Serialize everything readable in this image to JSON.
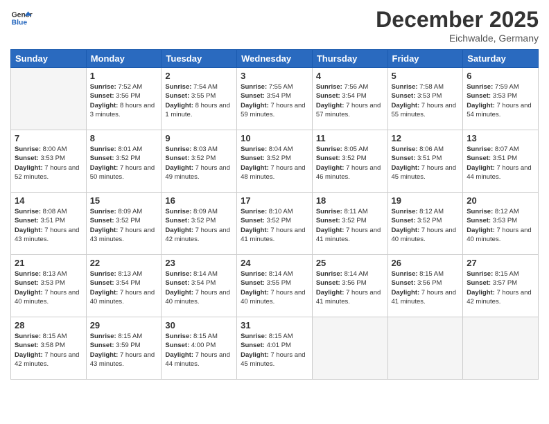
{
  "header": {
    "logo_line1": "General",
    "logo_line2": "Blue",
    "month": "December 2025",
    "location": "Eichwalde, Germany"
  },
  "weekdays": [
    "Sunday",
    "Monday",
    "Tuesday",
    "Wednesday",
    "Thursday",
    "Friday",
    "Saturday"
  ],
  "weeks": [
    [
      {
        "day": "",
        "empty": true
      },
      {
        "day": "1",
        "sunrise": "7:52 AM",
        "sunset": "3:56 PM",
        "daylight": "8 hours and 3 minutes."
      },
      {
        "day": "2",
        "sunrise": "7:54 AM",
        "sunset": "3:55 PM",
        "daylight": "8 hours and 1 minute."
      },
      {
        "day": "3",
        "sunrise": "7:55 AM",
        "sunset": "3:54 PM",
        "daylight": "7 hours and 59 minutes."
      },
      {
        "day": "4",
        "sunrise": "7:56 AM",
        "sunset": "3:54 PM",
        "daylight": "7 hours and 57 minutes."
      },
      {
        "day": "5",
        "sunrise": "7:58 AM",
        "sunset": "3:53 PM",
        "daylight": "7 hours and 55 minutes."
      },
      {
        "day": "6",
        "sunrise": "7:59 AM",
        "sunset": "3:53 PM",
        "daylight": "7 hours and 54 minutes."
      }
    ],
    [
      {
        "day": "7",
        "sunrise": "8:00 AM",
        "sunset": "3:53 PM",
        "daylight": "7 hours and 52 minutes."
      },
      {
        "day": "8",
        "sunrise": "8:01 AM",
        "sunset": "3:52 PM",
        "daylight": "7 hours and 50 minutes."
      },
      {
        "day": "9",
        "sunrise": "8:03 AM",
        "sunset": "3:52 PM",
        "daylight": "7 hours and 49 minutes."
      },
      {
        "day": "10",
        "sunrise": "8:04 AM",
        "sunset": "3:52 PM",
        "daylight": "7 hours and 48 minutes."
      },
      {
        "day": "11",
        "sunrise": "8:05 AM",
        "sunset": "3:52 PM",
        "daylight": "7 hours and 46 minutes."
      },
      {
        "day": "12",
        "sunrise": "8:06 AM",
        "sunset": "3:51 PM",
        "daylight": "7 hours and 45 minutes."
      },
      {
        "day": "13",
        "sunrise": "8:07 AM",
        "sunset": "3:51 PM",
        "daylight": "7 hours and 44 minutes."
      }
    ],
    [
      {
        "day": "14",
        "sunrise": "8:08 AM",
        "sunset": "3:51 PM",
        "daylight": "7 hours and 43 minutes."
      },
      {
        "day": "15",
        "sunrise": "8:09 AM",
        "sunset": "3:52 PM",
        "daylight": "7 hours and 43 minutes."
      },
      {
        "day": "16",
        "sunrise": "8:09 AM",
        "sunset": "3:52 PM",
        "daylight": "7 hours and 42 minutes."
      },
      {
        "day": "17",
        "sunrise": "8:10 AM",
        "sunset": "3:52 PM",
        "daylight": "7 hours and 41 minutes."
      },
      {
        "day": "18",
        "sunrise": "8:11 AM",
        "sunset": "3:52 PM",
        "daylight": "7 hours and 41 minutes."
      },
      {
        "day": "19",
        "sunrise": "8:12 AM",
        "sunset": "3:52 PM",
        "daylight": "7 hours and 40 minutes."
      },
      {
        "day": "20",
        "sunrise": "8:12 AM",
        "sunset": "3:53 PM",
        "daylight": "7 hours and 40 minutes."
      }
    ],
    [
      {
        "day": "21",
        "sunrise": "8:13 AM",
        "sunset": "3:53 PM",
        "daylight": "7 hours and 40 minutes."
      },
      {
        "day": "22",
        "sunrise": "8:13 AM",
        "sunset": "3:54 PM",
        "daylight": "7 hours and 40 minutes."
      },
      {
        "day": "23",
        "sunrise": "8:14 AM",
        "sunset": "3:54 PM",
        "daylight": "7 hours and 40 minutes."
      },
      {
        "day": "24",
        "sunrise": "8:14 AM",
        "sunset": "3:55 PM",
        "daylight": "7 hours and 40 minutes."
      },
      {
        "day": "25",
        "sunrise": "8:14 AM",
        "sunset": "3:56 PM",
        "daylight": "7 hours and 41 minutes."
      },
      {
        "day": "26",
        "sunrise": "8:15 AM",
        "sunset": "3:56 PM",
        "daylight": "7 hours and 41 minutes."
      },
      {
        "day": "27",
        "sunrise": "8:15 AM",
        "sunset": "3:57 PM",
        "daylight": "7 hours and 42 minutes."
      }
    ],
    [
      {
        "day": "28",
        "sunrise": "8:15 AM",
        "sunset": "3:58 PM",
        "daylight": "7 hours and 42 minutes."
      },
      {
        "day": "29",
        "sunrise": "8:15 AM",
        "sunset": "3:59 PM",
        "daylight": "7 hours and 43 minutes."
      },
      {
        "day": "30",
        "sunrise": "8:15 AM",
        "sunset": "4:00 PM",
        "daylight": "7 hours and 44 minutes."
      },
      {
        "day": "31",
        "sunrise": "8:15 AM",
        "sunset": "4:01 PM",
        "daylight": "7 hours and 45 minutes."
      },
      {
        "day": "",
        "empty": true
      },
      {
        "day": "",
        "empty": true
      },
      {
        "day": "",
        "empty": true
      }
    ]
  ],
  "labels": {
    "sunrise": "Sunrise:",
    "sunset": "Sunset:",
    "daylight": "Daylight:"
  }
}
